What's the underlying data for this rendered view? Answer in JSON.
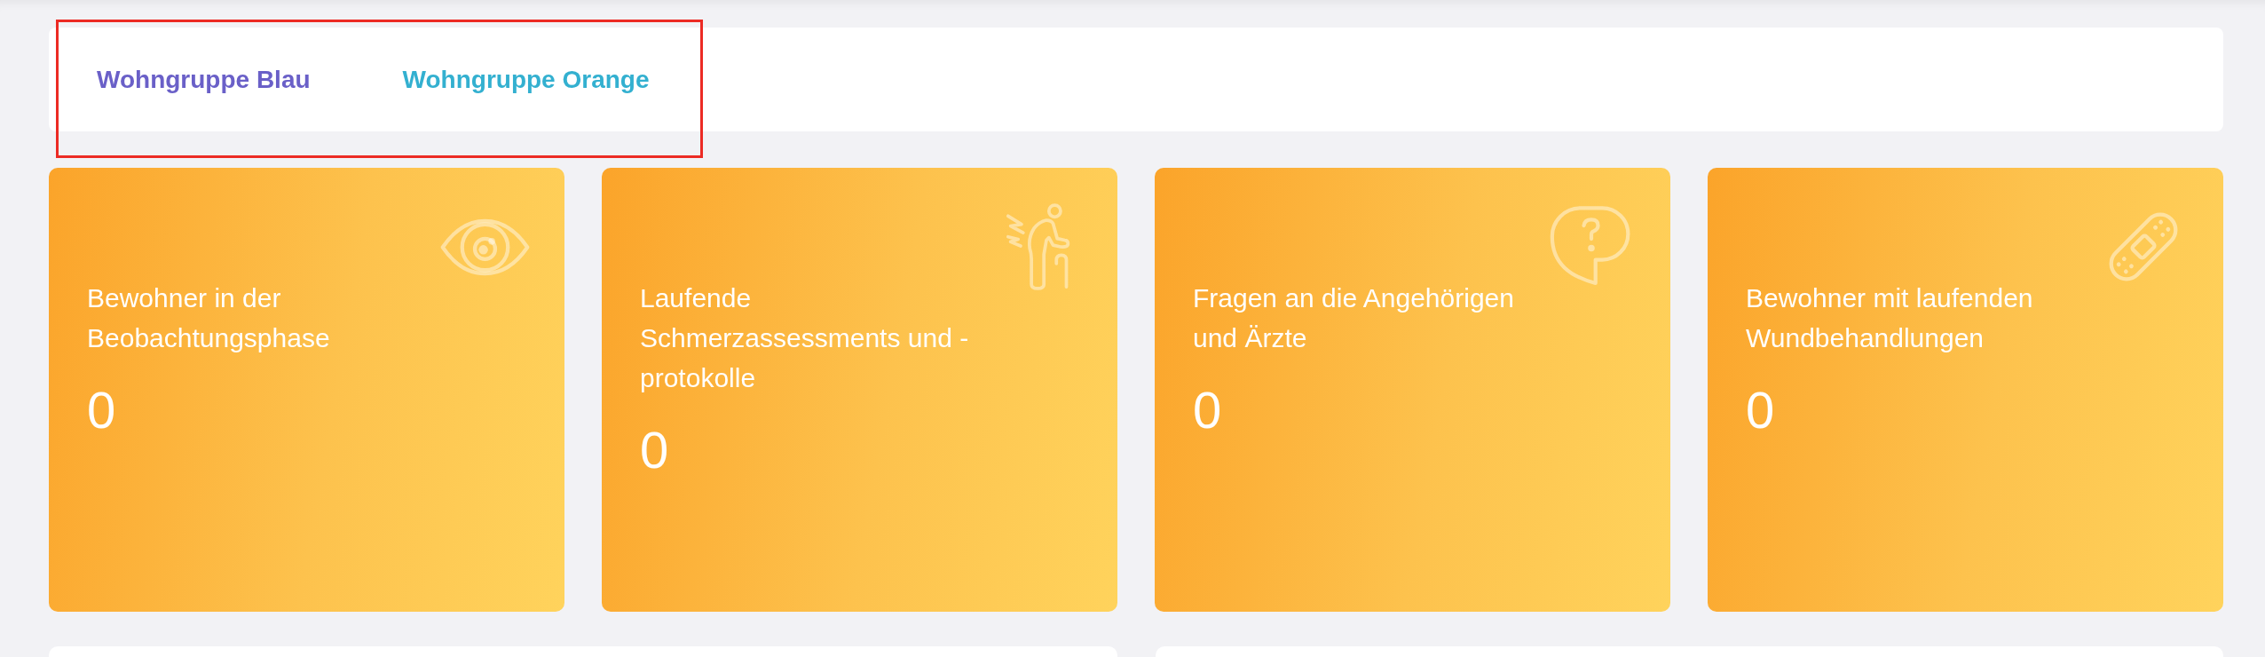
{
  "nav": {
    "tabs": [
      {
        "label": "Wohngruppe Blau",
        "selected": true
      },
      {
        "label": "Wohngruppe Orange",
        "selected": false
      }
    ]
  },
  "cards": [
    {
      "title": "Bewohner in der Beobachtungsphase",
      "count": "0"
    },
    {
      "title": "Laufende Schmerzassessments und - protokolle",
      "count": "0"
    },
    {
      "title": "Fragen an die Angehörigen und Ärzte",
      "count": "0"
    },
    {
      "title": "Bewohner mit laufenden Wundbehandlungen",
      "count": "0"
    }
  ]
}
